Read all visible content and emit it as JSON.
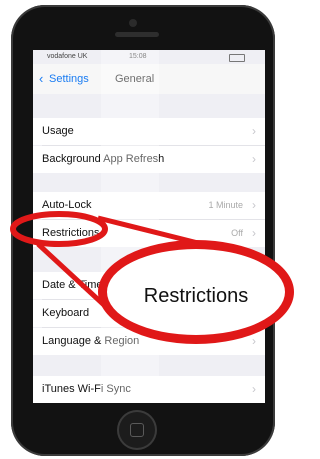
{
  "status_bar": {
    "carrier": "vodafone UK",
    "time": "15:08"
  },
  "nav": {
    "back_label": "Settings",
    "back_chevron": "‹",
    "title": "General"
  },
  "rows": [
    {
      "label": "Usage",
      "value": ""
    },
    {
      "label": "Background App Refresh",
      "value": ""
    },
    {
      "label": "Auto-Lock",
      "value": "1 Minute"
    },
    {
      "label": "Restrictions",
      "value": "Off"
    },
    {
      "label": "Date & Time",
      "value": ""
    },
    {
      "label": "Keyboard",
      "value": ""
    },
    {
      "label": "Language & Region",
      "value": ""
    },
    {
      "label": "iTunes Wi-Fi Sync",
      "value": ""
    }
  ],
  "chevron_glyph": "›",
  "callout": {
    "text": "Restrictions"
  },
  "colors": {
    "accent": "#1a7cf2",
    "highlight_red": "#e01818",
    "phone_body": "#121212"
  },
  "icons": [
    "chevron-left-icon",
    "chevron-right-icon",
    "home-button-icon"
  ]
}
